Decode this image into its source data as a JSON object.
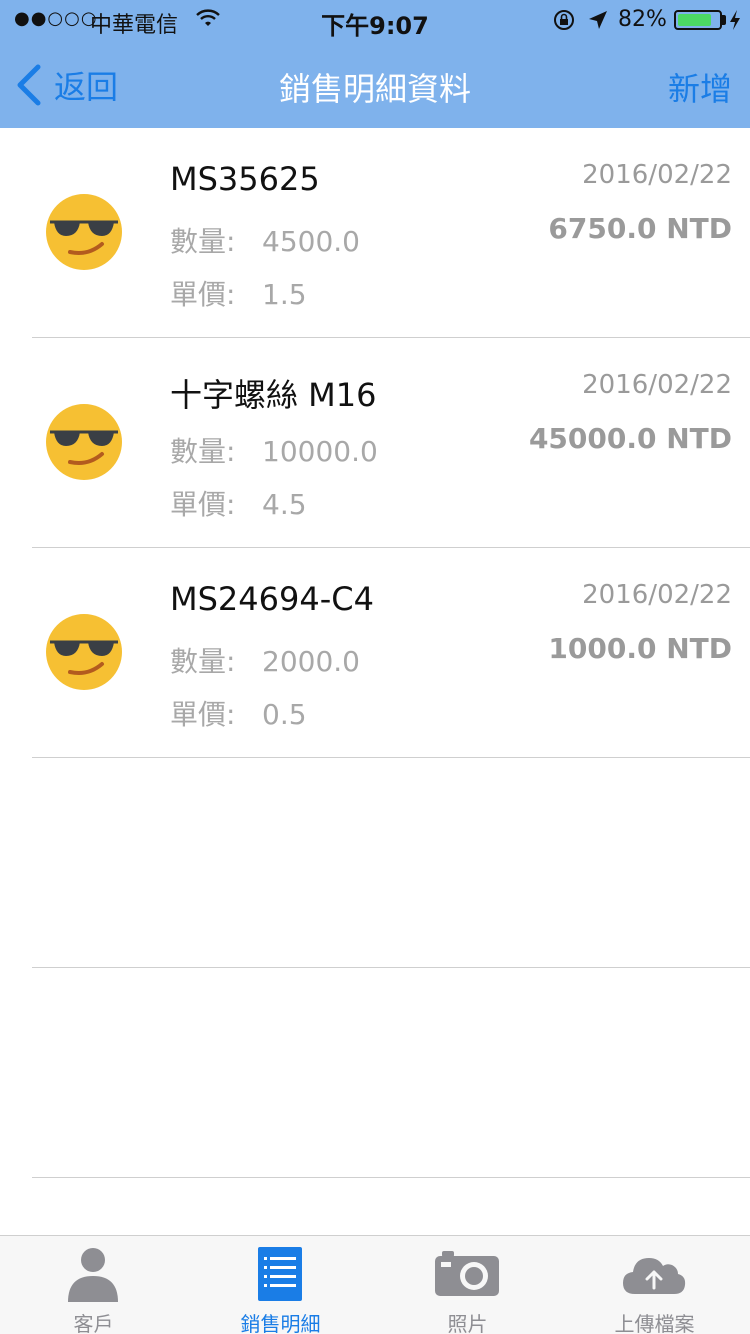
{
  "status_bar": {
    "signal": "●●○○○",
    "carrier": "中華電信",
    "time": "下午9:07",
    "battery_percent": "82%",
    "battery_level": 0.82
  },
  "nav": {
    "back_label": "返回",
    "title": "銷售明細資料",
    "add_label": "新增"
  },
  "labels": {
    "quantity": "數量:",
    "unit_price": "單價:"
  },
  "sales": [
    {
      "name": "MS35625",
      "date": "2016/02/22",
      "quantity": "4500.0",
      "unit_price": "1.5",
      "total": "6750.0 NTD"
    },
    {
      "name": "十字螺絲 M16",
      "date": "2016/02/22",
      "quantity": "10000.0",
      "unit_price": "4.5",
      "total": "45000.0 NTD"
    },
    {
      "name": "MS24694-C4",
      "date": "2016/02/22",
      "quantity": "2000.0",
      "unit_price": "0.5",
      "total": "1000.0 NTD"
    }
  ],
  "tabs": [
    {
      "label": "客戶",
      "icon": "person-icon",
      "active": false
    },
    {
      "label": "銷售明細",
      "icon": "list-icon",
      "active": true
    },
    {
      "label": "照片",
      "icon": "camera-icon",
      "active": false
    },
    {
      "label": "上傳檔案",
      "icon": "cloud-upload-icon",
      "active": false
    }
  ],
  "colors": {
    "nav_bar": "#7fb2ec",
    "accent": "#1a7de6",
    "muted_text": "#9a9a9a",
    "battery": "#4cd964"
  }
}
